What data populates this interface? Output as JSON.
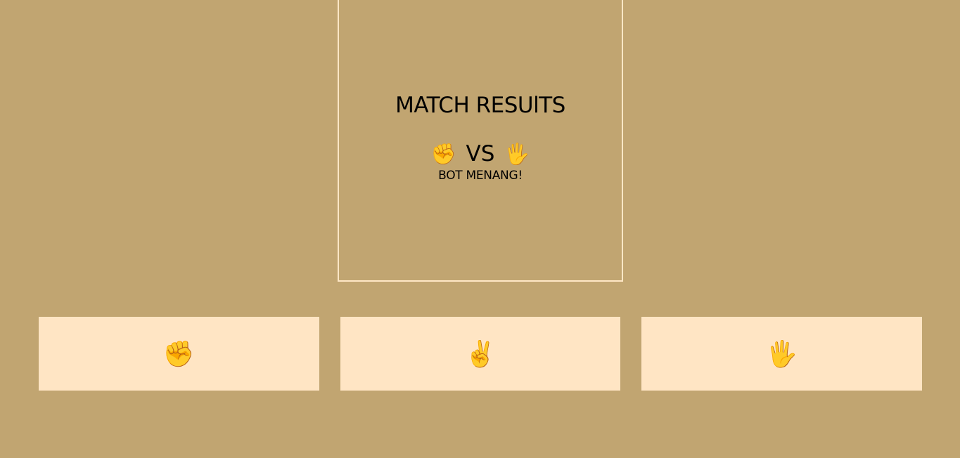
{
  "result": {
    "title": "MATCH RESUlTS",
    "player_hand": "✊",
    "vs_label": "VS",
    "bot_hand": "🖐",
    "outcome": "BOT MENANG!"
  },
  "choices": [
    {
      "name": "rock",
      "icon": "✊"
    },
    {
      "name": "scissors",
      "icon": "✌"
    },
    {
      "name": "paper",
      "icon": "🖐"
    }
  ],
  "colors": {
    "background": "#c1a571",
    "panel_border": "#ffe7c6",
    "button_bg": "#ffe5c4"
  }
}
